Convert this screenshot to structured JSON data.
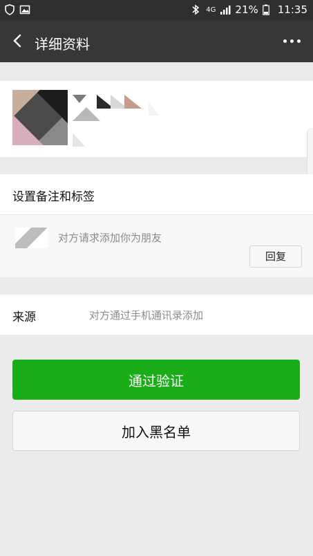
{
  "status_bar": {
    "left_icons": [
      "shield-icon",
      "image-icon"
    ],
    "network": "4G",
    "battery": "21%",
    "time": "11:35"
  },
  "nav": {
    "title": "详细资料",
    "back_icon": "back-arrow-icon",
    "more_icon": "more-dots-icon"
  },
  "profile": {
    "avatar": "pixelated-avatar"
  },
  "remark": {
    "label": "设置备注和标签"
  },
  "request": {
    "message": "对方请求添加你为朋友",
    "reply_label": "回复"
  },
  "source": {
    "key": "来源",
    "value": "对方通过手机通讯录添加"
  },
  "actions": {
    "verify_label": "通过验证",
    "block_label": "加入黑名单"
  },
  "colors": {
    "primary_green": "#1aad19",
    "nav_bg": "#373737",
    "statusbar_bg": "#2f2f2f"
  }
}
